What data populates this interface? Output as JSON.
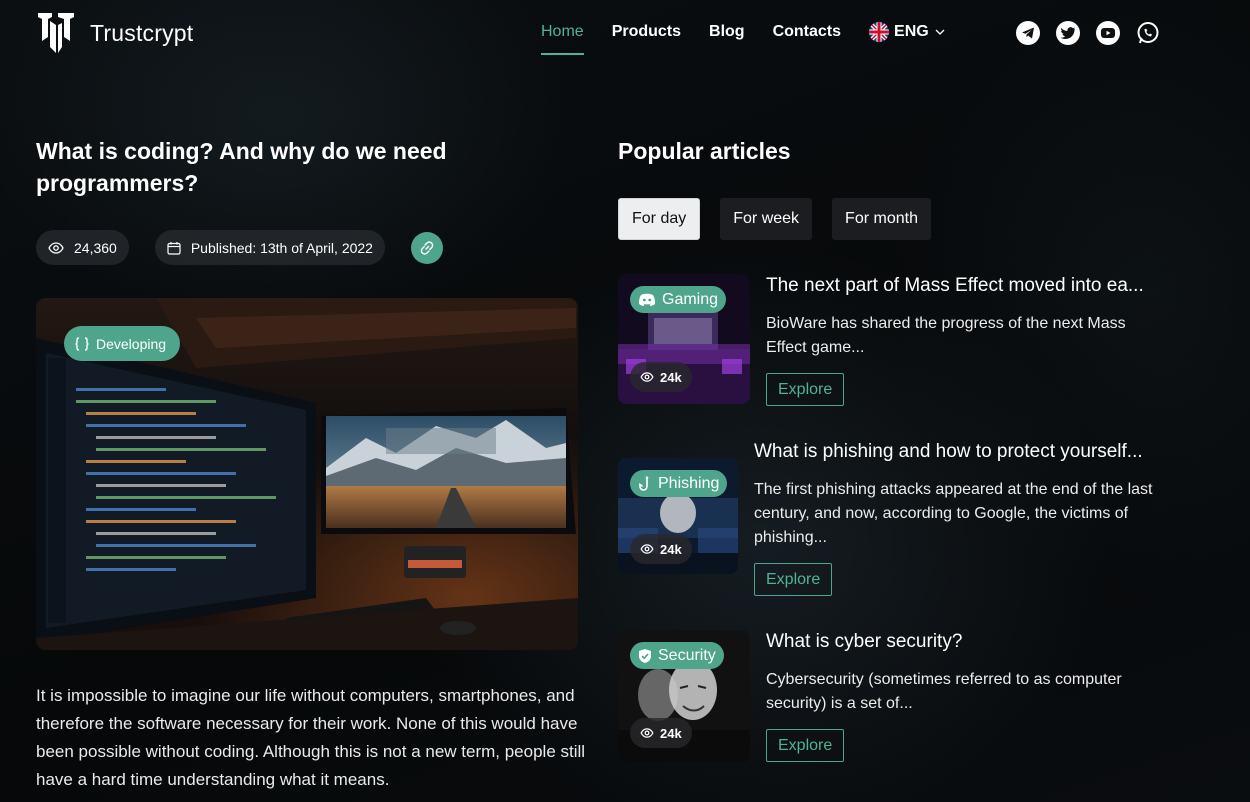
{
  "brand": {
    "name": "Trustcrypt"
  },
  "nav": {
    "items": [
      "Home",
      "Products",
      "Blog",
      "Contacts"
    ],
    "active": "Home",
    "language": "ENG"
  },
  "socials": [
    "telegram-icon",
    "twitter-icon",
    "youtube-icon",
    "whatsapp-icon"
  ],
  "article": {
    "title": "What is coding? And why do we need programmers?",
    "views": "24,360",
    "published": "Published: 13th of April, 2022",
    "category": "Developing",
    "body": "It is impossible to imagine our life without computers, smartphones, and therefore the software necessary for their work. None of this would have been possible without coding. Although this is not a new term, people still have a hard time understanding what it means."
  },
  "popular": {
    "title": "Popular articles",
    "tabs": [
      "For day",
      "For week",
      "For month"
    ],
    "active_tab": "For day",
    "explore_label": "Explore",
    "cards": [
      {
        "category": "Gaming",
        "views": "24k",
        "title": "The next part of Mass Effect moved into ea...",
        "desc": "BioWare has shared the progress of the next Mass Effect game..."
      },
      {
        "category": "Phishing",
        "views": "24k",
        "title": "What is phishing and how to protect yourself...",
        "desc": "The first phishing attacks appeared at the end of the last century, and now, according to Google, the victims of phishing..."
      },
      {
        "category": "Security",
        "views": "24k",
        "title": "What is cyber security?",
        "desc": "Cybersecurity (sometimes referred to as computer security) is a set of..."
      }
    ]
  },
  "colors": {
    "accent": "#4fa58b",
    "accent_text": "#4fb396",
    "background": "#07090b"
  }
}
